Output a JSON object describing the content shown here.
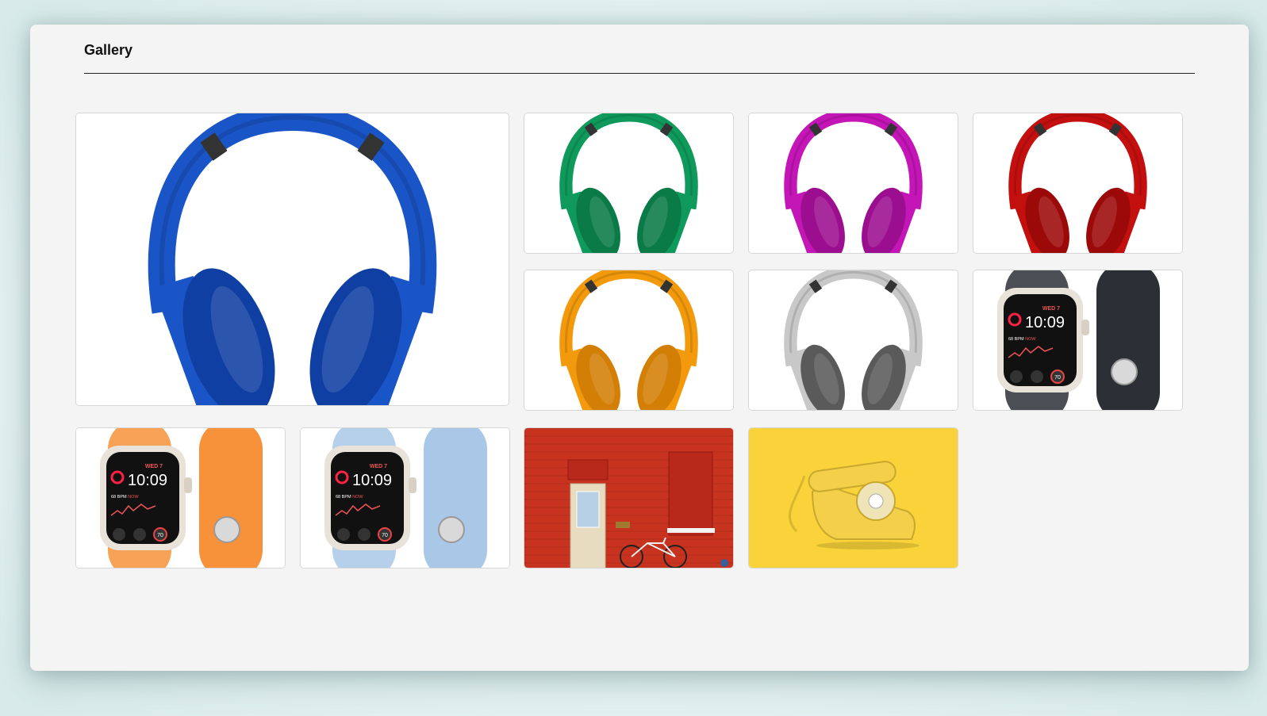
{
  "gallery": {
    "title": "Gallery",
    "items": [
      {
        "kind": "headphones",
        "color": "#1a55c8",
        "dark": "#0f3fa3"
      },
      {
        "kind": "headphones",
        "color": "#0f9a5c",
        "dark": "#0a7a47"
      },
      {
        "kind": "headphones",
        "color": "#c415b6",
        "dark": "#9c0e90"
      },
      {
        "kind": "headphones",
        "color": "#c40f0f",
        "dark": "#9c0909"
      },
      {
        "kind": "headphones",
        "color": "#f29a0c",
        "dark": "#d37f05"
      },
      {
        "kind": "headphones",
        "color": "#c8c8c8",
        "dark": "#5a5a5a"
      },
      {
        "kind": "watch",
        "band": "#2c2f36",
        "time": "10:09",
        "day": "WED 7",
        "bpm": "68 BPM",
        "now": "NOW",
        "ring": "70"
      },
      {
        "kind": "watch",
        "band": "#f7923a",
        "time": "10:09",
        "day": "WED 7",
        "bpm": "68 BPM",
        "now": "NOW",
        "ring": "70"
      },
      {
        "kind": "watch",
        "band": "#a9c7e6",
        "time": "10:09",
        "day": "WED 7",
        "bpm": "68 BPM",
        "now": "NOW",
        "ring": "70"
      },
      {
        "kind": "building",
        "wall": "#c8331f"
      },
      {
        "kind": "telephone",
        "bg": "#f9d339",
        "phone": "#f3cf4a"
      }
    ]
  }
}
